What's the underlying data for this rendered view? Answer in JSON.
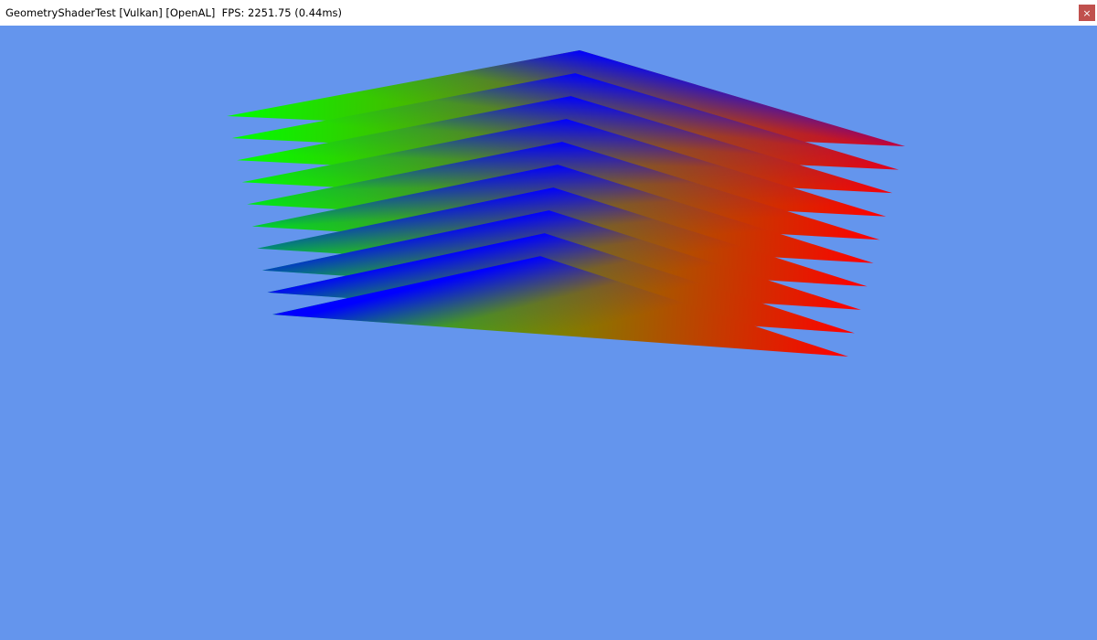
{
  "window": {
    "title": "GeometryShaderTest [Vulkan] [OpenAL]  FPS: 2251.75 (0.44ms)",
    "close_label": "×"
  },
  "scene": {
    "clear_color": "#6495ed",
    "vertex_colors": {
      "left": "#00ff00",
      "apex": "#0000ff",
      "right": "#ff0000"
    },
    "triangle_count": 10
  }
}
